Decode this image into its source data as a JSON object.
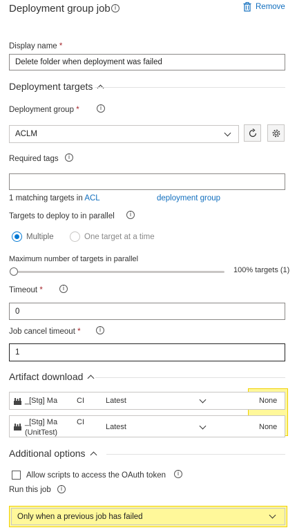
{
  "header": {
    "title": "Deployment group job",
    "remove_label": "Remove"
  },
  "display_name": {
    "label": "Display name",
    "required": "*",
    "value": "Delete folder when deployment was failed"
  },
  "deployment_targets": {
    "section_title": "Deployment targets",
    "group_label": "Deployment group",
    "required": "*",
    "group_value": "ACLM",
    "tags_label": "Required tags",
    "tags_value": "",
    "matching_text": "1 matching targets in",
    "matching_link": "ACL",
    "deployment_group_link": "deployment group",
    "parallel_label": "Targets to deploy to in parallel",
    "option_multiple": "Multiple",
    "option_one": "One target at a time",
    "selected_option": "Multiple",
    "max_label": "Maximum number of targets in parallel",
    "max_value_text": "100% targets (1)",
    "max_slider_fraction": 0.0
  },
  "timeout": {
    "label": "Timeout",
    "required": "*",
    "value": "0"
  },
  "job_cancel_timeout": {
    "label": "Job cancel timeout",
    "required": "*",
    "value": "1"
  },
  "artifact_download": {
    "section_title": "Artifact download",
    "rows": [
      {
        "name_line1": "_[Stg] Ma",
        "name_suffix": "CI",
        "name_line2": "",
        "version": "Latest",
        "selection": "None"
      },
      {
        "name_line1": "_[Stg] Ma",
        "name_suffix": "CI",
        "name_line2": "(UnitTest)",
        "version": "Latest",
        "selection": "None"
      }
    ]
  },
  "additional_options": {
    "section_title": "Additional options",
    "oauth_label": "Allow scripts to access the OAuth token",
    "oauth_checked": false,
    "run_label": "Run this job",
    "run_value": "Only when a previous job has failed"
  },
  "colors": {
    "accent": "#0078d4",
    "highlight": "#fff89a",
    "highlight_border": "#f0d000",
    "required": "#a4262c"
  },
  "icons": [
    "info-icon",
    "trash-icon",
    "chevron-up-icon",
    "chevron-down-icon",
    "refresh-icon",
    "gear-icon",
    "build-artifact-icon"
  ]
}
